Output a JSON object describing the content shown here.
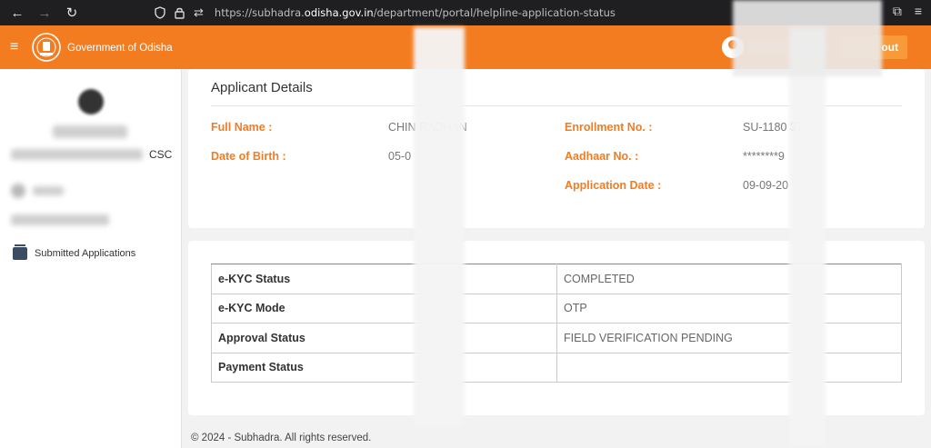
{
  "browser": {
    "url_prefix": "https://subhadra.",
    "url_domain": "odisha.gov.in",
    "url_path": "/department/portal/helpline-application-status"
  },
  "header": {
    "gov_title": "Government of Odisha",
    "logout_label": "out",
    "accent_color": "#f47c20"
  },
  "sidebar": {
    "role_label": "CSC",
    "nav_item_label": "Submitted Applications"
  },
  "applicant_details": {
    "title": "Applicant Details",
    "full_name_label": "Full Name :",
    "full_name_value": "CHIN          RADHAN",
    "dob_label": "Date of Birth :",
    "dob_value": "05-0",
    "enrollment_label": "Enrollment No. :",
    "enrollment_value": "SU-1180          37",
    "aadhaar_label": "Aadhaar No. :",
    "aadhaar_value": "********9",
    "app_date_label": "Application Date :",
    "app_date_value": "09-09-20"
  },
  "status_table": [
    {
      "key": "e-KYC Status",
      "value": "COMPLETED"
    },
    {
      "key": "e-KYC Mode",
      "value": "OTP"
    },
    {
      "key": "Approval Status",
      "value": "FIELD VERIFICATION PENDING"
    },
    {
      "key": "Payment Status",
      "value": ""
    }
  ],
  "footer": {
    "copyright": "© 2024 - Subhadra. All rights reserved."
  }
}
